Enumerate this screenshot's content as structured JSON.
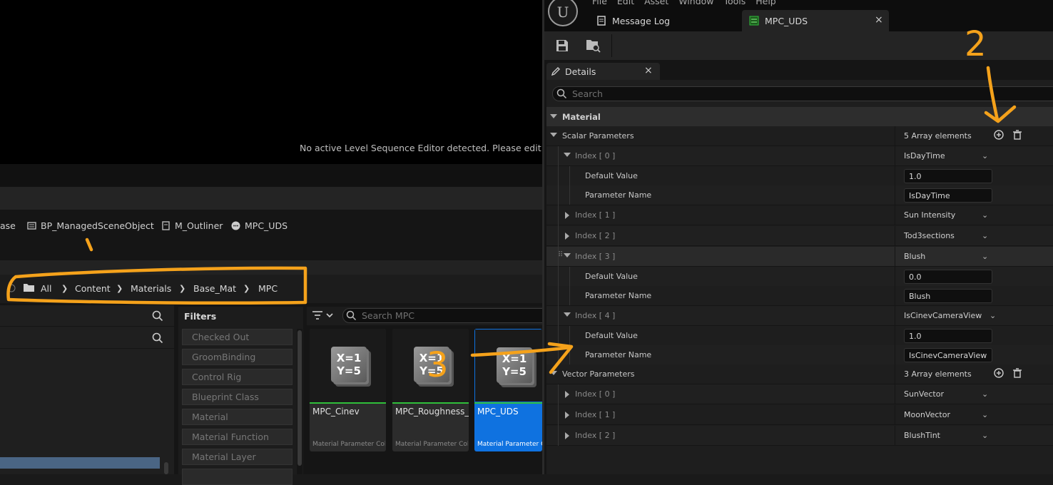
{
  "viewport": {
    "message": "No active Level Sequence Editor detected. Please edit a Lev"
  },
  "favorites": [
    {
      "label": "ase",
      "icon": "none"
    },
    {
      "label": "BP_ManagedSceneObject",
      "icon": "blueprint-icon"
    },
    {
      "label": "M_Outliner",
      "icon": "material-icon"
    },
    {
      "label": "MPC_UDS",
      "icon": "mpc-icon"
    }
  ],
  "breadcrumb": [
    "All",
    "Content",
    "Materials",
    "Base_Mat",
    "MPC"
  ],
  "filters": {
    "title": "Filters",
    "items": [
      "Checked Out",
      "GroomBinding",
      "Control Rig",
      "Blueprint Class",
      "Material",
      "Material Function",
      "Material Layer"
    ]
  },
  "asset_search": {
    "placeholder": "Search MPC"
  },
  "assets": [
    {
      "name": "MPC_Cinev",
      "type": "Material Parameter Col...",
      "thumb": [
        "X=1",
        "Y=5"
      ]
    },
    {
      "name": "MPC_Roughness_Env",
      "type": "Material Parameter Col...",
      "thumb": [
        "X=1",
        "Y=5"
      ]
    },
    {
      "name": "MPC_UDS",
      "type": "Material Parameter Co",
      "thumb": [
        "X=1",
        "Y=5"
      ]
    }
  ],
  "menu": "File Edit Asset Window Tools Help",
  "tabs": {
    "message_log": "Message Log",
    "mpc": "MPC_UDS"
  },
  "details": {
    "tab": "Details",
    "search_placeholder": "Search",
    "category": "Material",
    "scalar": {
      "label": "Scalar Parameters",
      "count": "5 Array elements",
      "items": [
        {
          "index": "Index [ 0 ]",
          "name": "IsDayTime",
          "default_label": "Default Value",
          "default": "1.0",
          "param_label": "Parameter Name",
          "param": "IsDayTime"
        },
        {
          "index": "Index [ 1 ]",
          "name": "Sun Intensity"
        },
        {
          "index": "Index [ 2 ]",
          "name": "Tod3sections"
        },
        {
          "index": "Index [ 3 ]",
          "name": "Blush",
          "default_label": "Default Value",
          "default": "0.0",
          "param_label": "Parameter Name",
          "param": "Blush"
        },
        {
          "index": "Index [ 4 ]",
          "name": "IsCinevCameraView",
          "default_label": "Default Value",
          "default": "1.0",
          "param_label": "Parameter Name",
          "param": "IsCinevCameraView"
        }
      ]
    },
    "vector": {
      "label": "Vector Parameters",
      "count": "3 Array elements",
      "items": [
        {
          "index": "Index [ 0 ]",
          "name": "SunVector"
        },
        {
          "index": "Index [ 1 ]",
          "name": "MoonVector"
        },
        {
          "index": "Index [ 2 ]",
          "name": "BlushTint"
        }
      ]
    }
  },
  "annotations": {
    "n2": "2",
    "n3": "3"
  },
  "colors": {
    "accent": "#0f72e0",
    "annotation": "#f5a21b",
    "mpc_green": "#2fbf3a"
  }
}
